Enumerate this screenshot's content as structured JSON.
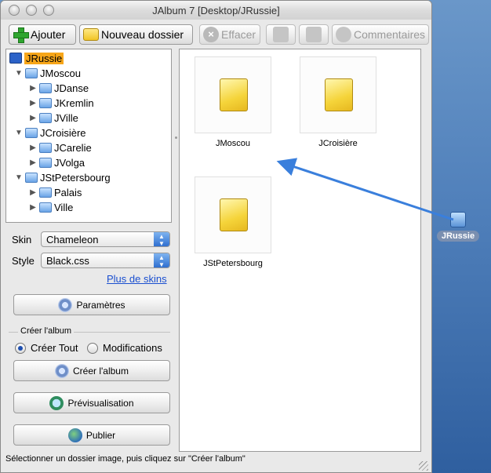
{
  "window": {
    "title": "JAlbum 7 [Desktop/JRussie]"
  },
  "toolbar": {
    "add_label": "Ajouter",
    "new_folder_label": "Nouveau dossier",
    "delete_label": "Effacer",
    "comments_label": "Commentaires"
  },
  "tree": {
    "root": "JRussie",
    "nodes": [
      {
        "label": "JMoscou",
        "level": 1,
        "expanded": true
      },
      {
        "label": "JDanse",
        "level": 2,
        "expanded": false
      },
      {
        "label": "JKremlin",
        "level": 2,
        "expanded": false
      },
      {
        "label": "JVille",
        "level": 2,
        "expanded": false
      },
      {
        "label": "JCroisière",
        "level": 1,
        "expanded": true
      },
      {
        "label": "JCarelie",
        "level": 2,
        "expanded": false
      },
      {
        "label": "JVolga",
        "level": 2,
        "expanded": false
      },
      {
        "label": "JStPetersbourg",
        "level": 1,
        "expanded": true
      },
      {
        "label": "Palais",
        "level": 2,
        "expanded": false
      },
      {
        "label": "Ville",
        "level": 2,
        "expanded": false
      }
    ]
  },
  "settings": {
    "skin_label": "Skin",
    "skin_value": "Chameleon",
    "style_label": "Style",
    "style_value": "Black.css",
    "more_skins_link": "Plus de skins",
    "params_button": "Paramètres"
  },
  "create": {
    "group_title": "Créer l'album",
    "option_all": "Créer Tout",
    "option_changes": "Modifications",
    "create_button": "Créer l'album",
    "preview_button": "Prévisualisation",
    "publish_button": "Publier"
  },
  "content": {
    "items": [
      "JMoscou",
      "JCroisière",
      "JStPetersbourg"
    ]
  },
  "desktop": {
    "icon_label": "JRussie"
  },
  "status": {
    "text": "Sélectionner un dossier image, puis cliquez sur \"Créer l'album\""
  },
  "colors": {
    "selection": "#f7a619",
    "accent_blue": "#2f6fd0",
    "link": "#1a4fd0",
    "arrow": "#3a7fdc"
  }
}
